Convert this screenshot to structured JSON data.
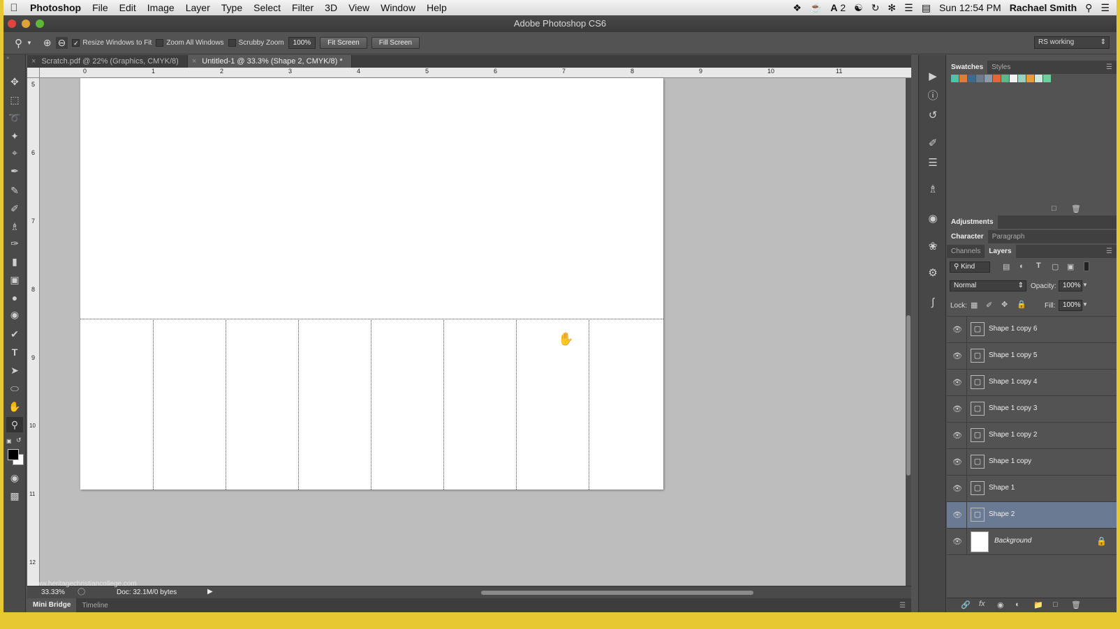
{
  "menubar": {
    "apple_icon": "apple-icon",
    "app": "Photoshop",
    "items": [
      "File",
      "Edit",
      "Image",
      "Layer",
      "Type",
      "Select",
      "Filter",
      "3D",
      "View",
      "Window",
      "Help"
    ],
    "adobe_badge": "2",
    "clock": "Sun 12:54 PM",
    "user": "Rachael Smith"
  },
  "window": {
    "title": "Adobe Photoshop CS6"
  },
  "options": {
    "resize_label": "Resize Windows to Fit",
    "resize_checked": "✓",
    "zoom_all_label": "Zoom All Windows",
    "scrubby_label": "Scrubby Zoom",
    "zoom_value": "100%",
    "fit_screen": "Fit Screen",
    "fill_screen": "Fill Screen",
    "workspace": "RS working"
  },
  "tabs": [
    {
      "label": "Scratch.pdf @ 22% (Graphics, CMYK/8)",
      "close": "×"
    },
    {
      "label": "Untitled-1 @ 33.3% (Shape 2, CMYK/8) *",
      "close": "×"
    }
  ],
  "rulers": {
    "h": [
      "0",
      "1",
      "2",
      "3",
      "4",
      "5",
      "6",
      "7",
      "8",
      "9",
      "10",
      "11"
    ],
    "v": [
      "5",
      "6",
      "7",
      "8",
      "9",
      "10",
      "11",
      "12"
    ]
  },
  "status": {
    "zoom": "33.33%",
    "doc": "Doc: 32.1M/0 bytes"
  },
  "watermark": "www.heritagechristiancollege.com",
  "bottom_tabs": [
    "Mini Bridge",
    "Timeline"
  ],
  "panels": {
    "swatches_tabs": [
      "Swatches",
      "Styles"
    ],
    "swatch_colors": [
      "#4fc3a8",
      "#e07b39",
      "#3d6b8c",
      "#6c7a89",
      "#8a9ba8",
      "#e8623a",
      "#58b98a",
      "#f2f2f2",
      "#9ad0c2",
      "#e89c3a",
      "#cfe8e0",
      "#6dcf9a"
    ],
    "adjustments": "Adjustments",
    "char_tabs": [
      "Character",
      "Paragraph"
    ],
    "layer_tabs": [
      "Channels",
      "Layers"
    ],
    "filter_kind": "Kind",
    "blend_mode": "Normal",
    "opacity_label": "Opacity:",
    "opacity": "100%",
    "lock_label": "Lock:",
    "fill_label": "Fill:",
    "fill": "100%",
    "layers": [
      {
        "name": "Shape 1 copy 6"
      },
      {
        "name": "Shape 1 copy 5"
      },
      {
        "name": "Shape 1 copy 4"
      },
      {
        "name": "Shape 1 copy 3"
      },
      {
        "name": "Shape 1 copy 2"
      },
      {
        "name": "Shape 1 copy"
      },
      {
        "name": "Shape 1"
      },
      {
        "name": "Shape 2"
      },
      {
        "name": "Background"
      }
    ]
  }
}
